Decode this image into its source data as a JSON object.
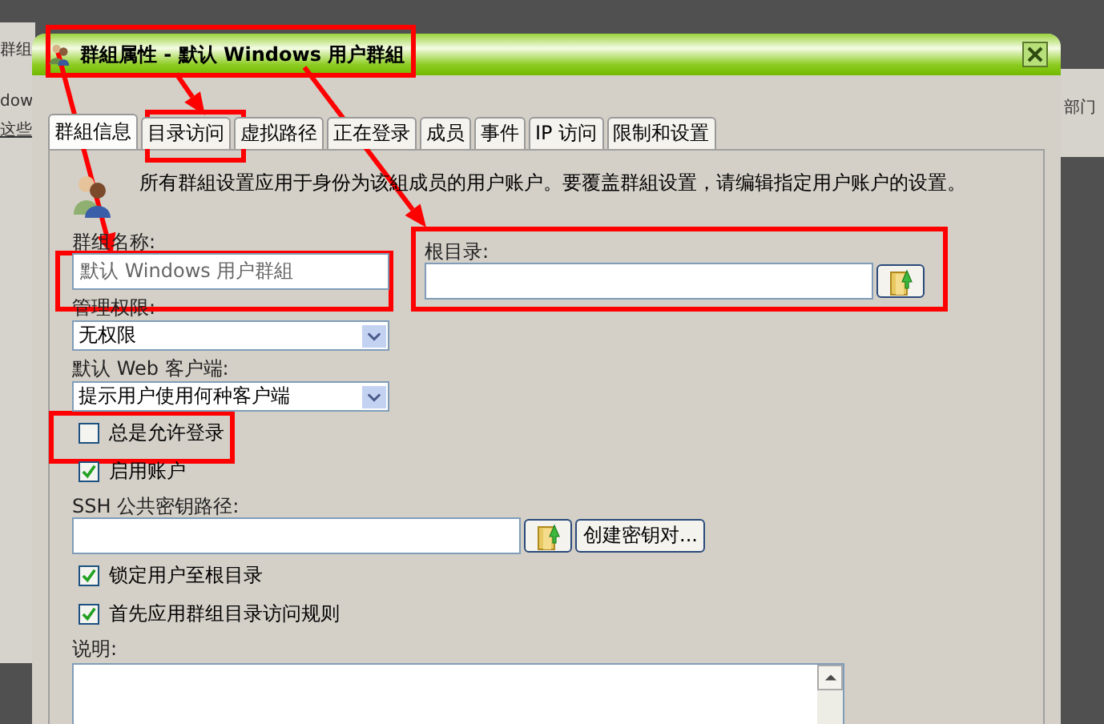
{
  "backdrop": {
    "texts": [
      {
        "kind": "top-left",
        "text": "群组"
      },
      {
        "kind": "left",
        "text": "dow"
      },
      {
        "kind": "left-link",
        "text": "这些"
      },
      {
        "kind": "right",
        "text": "部门"
      }
    ]
  },
  "window": {
    "title": "群組属性 - 默认 Windows 用户群組"
  },
  "tabs": [
    {
      "label": "群組信息",
      "selected": true
    },
    {
      "label": "目录访问",
      "selected": false
    },
    {
      "label": "虚拟路径",
      "selected": false
    },
    {
      "label": "正在登录",
      "selected": false
    },
    {
      "label": "成员",
      "selected": false
    },
    {
      "label": "事件",
      "selected": false
    },
    {
      "label": "IP 访问",
      "selected": false
    },
    {
      "label": "限制和设置",
      "selected": false
    }
  ],
  "notice": "所有群組设置应用于身份为该組成员的用户账户。要覆盖群組设置，请编辑指定用户账户的设置。",
  "left": [
    {
      "kind": "field",
      "label": "群组名称:",
      "value": "默认 Windows 用户群組",
      "disabled": true
    },
    {
      "kind": "select",
      "label": "管理权限:",
      "value": "无权限"
    },
    {
      "kind": "select",
      "label": "默认 Web 客户端:",
      "value": "提示用户使用何种客户端"
    },
    {
      "kind": "checkbox",
      "label": "总是允许登录",
      "checked": false
    },
    {
      "kind": "checkbox",
      "label": "启用账户",
      "checked": true
    },
    {
      "kind": "path",
      "label": "SSH 公共密钥路径:",
      "button": "创建密钥对..."
    },
    {
      "kind": "checkbox",
      "label": "锁定用户至根目录",
      "checked": true
    },
    {
      "kind": "checkbox",
      "label": "首先应用群组目录访问规则",
      "checked": true
    },
    {
      "kind": "textarea",
      "label": "说明:"
    }
  ],
  "right": {
    "label": "根目录:"
  }
}
